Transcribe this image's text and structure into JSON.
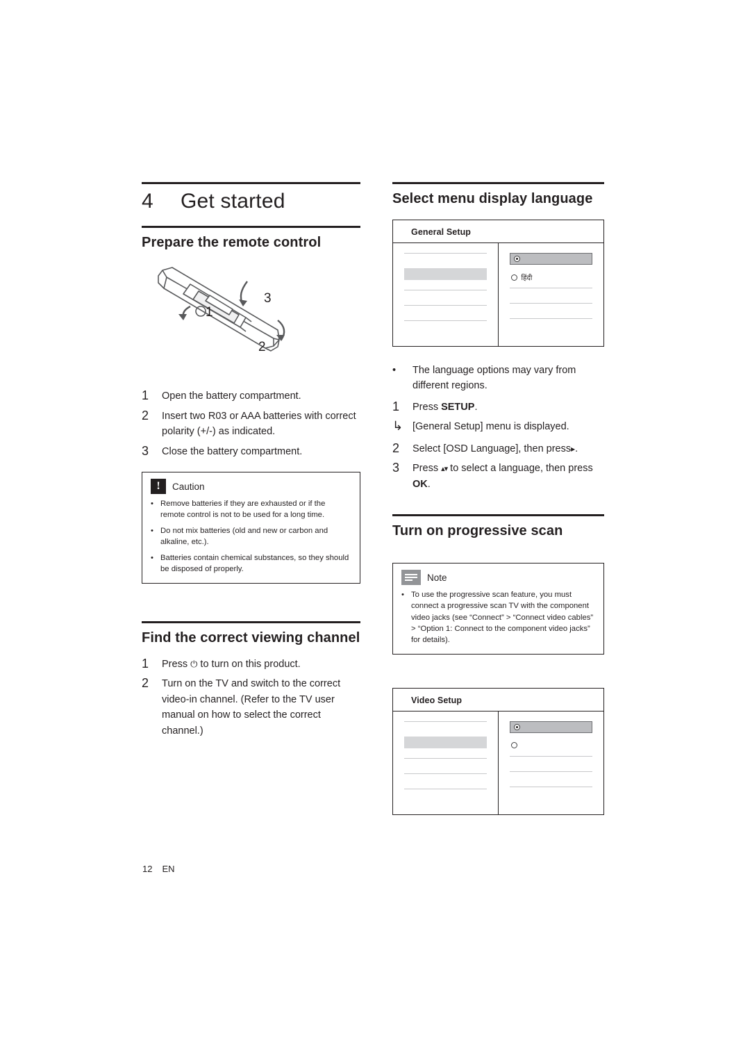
{
  "chapter": {
    "number": "4",
    "title": "Get started"
  },
  "left": {
    "section1_title": "Prepare the remote control",
    "illustration": {
      "callout1": "1",
      "callout2": "2",
      "callout3": "3"
    },
    "steps": [
      {
        "n": "1",
        "text": "Open the battery compartment."
      },
      {
        "n": "2",
        "text": "Insert two R03 or AAA batteries with correct polarity (+/-) as indicated."
      },
      {
        "n": "3",
        "text": "Close the battery compartment."
      }
    ],
    "caution": {
      "label": "Caution",
      "icon": "caution-icon",
      "items": [
        "Remove batteries if they are exhausted or if the remote control is not to be used for a long time.",
        "Do not mix batteries (old and new or carbon and alkaline, etc.).",
        "Batteries contain chemical substances, so they should be disposed of properly."
      ]
    },
    "section2_title": "Find the correct viewing channel",
    "steps2": [
      {
        "n": "1",
        "text_pre": "Press ",
        "symbol": "⏻",
        "text_post": " to turn on this product."
      },
      {
        "n": "2",
        "text": "Turn on the TV and switch to the correct video-in channel. (Refer to the TV user manual on how to select the correct channel.)"
      }
    ]
  },
  "right": {
    "section1_title": "Select menu display language",
    "osd1": {
      "title": "General Setup",
      "selected_option_icon": "radio-selected-icon",
      "option_label": "हिंदी"
    },
    "bullet": "The language options may vary from different regions.",
    "steps": [
      {
        "n": "1",
        "text_pre": "Press ",
        "bold": "SETUP",
        "text_post": "."
      },
      {
        "n": "2",
        "text_pre": "Select [OSD Language], then press",
        "symbol": "▸",
        "text_post": "."
      },
      {
        "n": "3",
        "text_pre": "Press ",
        "symbol": "▴▾",
        "text_post": " to select a language, then press ",
        "bold": "OK",
        "tail": "."
      }
    ],
    "substep_note": "[General Setup] menu is displayed.",
    "section2_title": "Turn on progressive scan",
    "note": {
      "label": "Note",
      "icon": "note-icon",
      "text": "To use the progressive scan feature, you must connect a progressive scan TV with the component video jacks (see “Connect” > “Connect video cables” > “Option 1: Connect to the component video jacks” for details)."
    },
    "osd2": {
      "title": "Video Setup",
      "selected_option_icon": "radio-selected-icon"
    }
  },
  "footer": {
    "page": "12",
    "lang": "EN"
  }
}
